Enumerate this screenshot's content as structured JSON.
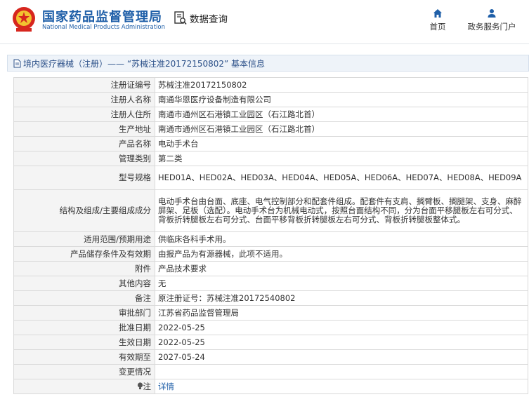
{
  "header": {
    "brand_cn": "国家药品监督管理局",
    "brand_en": "National Medical Products Administration",
    "query_label": "数据查询",
    "nav": [
      {
        "label": "首页",
        "icon": "home-icon"
      },
      {
        "label": "政务服务门户",
        "icon": "user-icon"
      }
    ]
  },
  "title_bar": {
    "text": "境内医疗器械（注册）——  “苏械注准20172150802”  基本信息"
  },
  "rows": [
    {
      "label": "注册证编号",
      "value": "苏械注准20172150802"
    },
    {
      "label": "注册人名称",
      "value": "南通华恩医疗设备制造有限公司"
    },
    {
      "label": "注册人住所",
      "value": "南通市通州区石港镇工业园区（石江路北首）"
    },
    {
      "label": "生产地址",
      "value": "南通市通州区石港镇工业园区（石江路北首）"
    },
    {
      "label": "产品名称",
      "value": "电动手术台"
    },
    {
      "label": "管理类别",
      "value": "第二类"
    },
    {
      "label": "型号规格",
      "value": "HED01A、HED02A、HED03A、HED04A、HED05A、HED06A、HED07A、HED08A、HED09A"
    },
    {
      "label": "结构及组成/主要组成成分",
      "value": "电动手术台由台面、底座、电气控制部分和配套件组成。配套件有支肩、搁臂板、搁腿架、支身、麻醉屏架、足板（选配）。电动手术台为机械电动式，按照台面结构不同，分为台面平移腿板左右可分式、背板折转腿板左右可分式、台面平移背板折转腿板左右可分式、背板折转腿板整体式。"
    },
    {
      "label": "适用范围/预期用途",
      "value": "供临床各科手术用。"
    },
    {
      "label": "产品储存条件及有效期",
      "value": "由报产品为有源器械，此项不适用。"
    },
    {
      "label": "附件",
      "value": "产品技术要求"
    },
    {
      "label": "其他内容",
      "value": "无"
    },
    {
      "label": "备注",
      "value": "原注册证号：苏械注准20172540802"
    },
    {
      "label": "审批部门",
      "value": "江苏省药品监督管理局"
    },
    {
      "label": "批准日期",
      "value": "2022-05-25"
    },
    {
      "label": "生效日期",
      "value": "2022-05-25"
    },
    {
      "label": "有效期至",
      "value": "2027-05-24"
    },
    {
      "label": "变更情况",
      "value": ""
    },
    {
      "label": "注",
      "value": "详情",
      "icon": "bulb-icon"
    }
  ],
  "colors": {
    "brand_blue": "#1f5fa8",
    "emblem_red": "#d7261e",
    "label_bg": "#f4f4f4",
    "border": "#dadada"
  }
}
